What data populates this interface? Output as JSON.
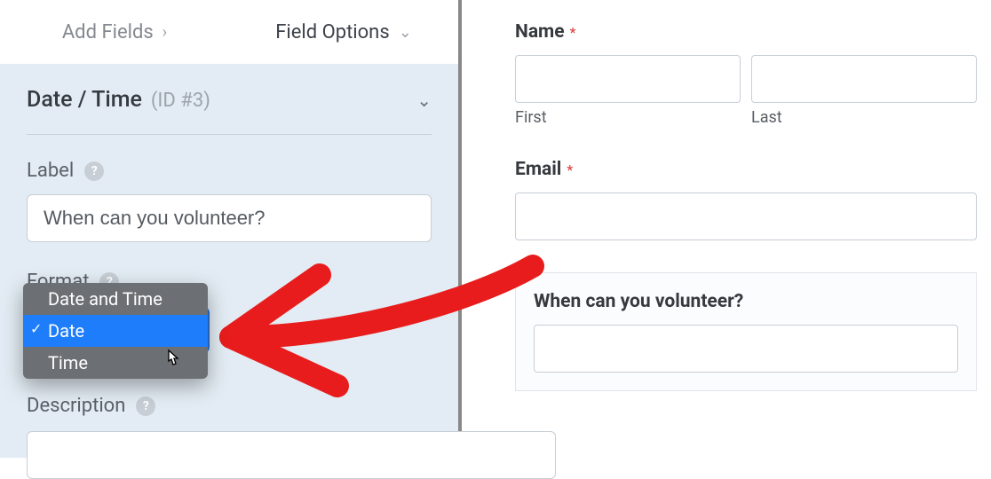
{
  "tabs": {
    "add_fields": "Add Fields",
    "field_options": "Field Options"
  },
  "section": {
    "title": "Date / Time",
    "id_label": "(ID #3)"
  },
  "labels": {
    "label": "Label",
    "format": "Format",
    "description": "Description"
  },
  "label_input_value": "When can you volunteer?",
  "format_dropdown": {
    "options": [
      "Date and Time",
      "Date",
      "Time"
    ],
    "selected": "Date"
  },
  "preview": {
    "name_label": "Name",
    "first": "First",
    "last": "Last",
    "email_label": "Email",
    "date_label": "When can you volunteer?",
    "required_marker": "*"
  }
}
